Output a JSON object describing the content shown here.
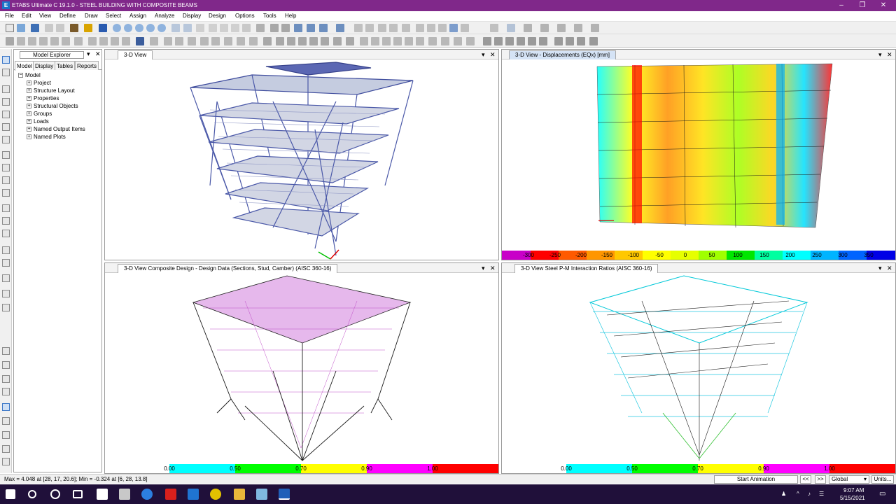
{
  "window": {
    "title": "ETABS Ultimate C 19.1.0 - STEEL BUILDING WITH COMPOSITE BEAMS",
    "logo_letter": "E",
    "minimize": "–",
    "restore": "❐",
    "close": "✕"
  },
  "menu": [
    "File",
    "Edit",
    "View",
    "Define",
    "Draw",
    "Select",
    "Assign",
    "Analyze",
    "Display",
    "Design",
    "Options",
    "Tools",
    "Help"
  ],
  "explorer": {
    "title": "Model Explorer",
    "pin": "▾",
    "close": "✕",
    "tabs": [
      "Model",
      "Display",
      "Tables",
      "Reports"
    ],
    "active_tab": "Model",
    "tree_root": "Model",
    "tree_items": [
      "Project",
      "Structure Layout",
      "Properties",
      "Structural Objects",
      "Groups",
      "Loads",
      "Named Output Items",
      "Named Plots"
    ]
  },
  "panes": {
    "top_left": {
      "title": "3-D View"
    },
    "top_right": {
      "title": "3-D View  - Displacements (EQx)  [mm]"
    },
    "bottom_left": {
      "title": "3-D View  Composite Design - Design Data (Sections, Stud, Camber)  (AISC 360-16)"
    },
    "bottom_right": {
      "title": "3-D View  Steel P-M Interaction Ratios  (AISC 360-16)"
    },
    "pane_dropdown": "▾",
    "pane_close": "✕"
  },
  "displacement_scale": {
    "labels": [
      "-300",
      "-250",
      "-200",
      "-150",
      "-100",
      "-50",
      "0",
      "50",
      "100",
      "150",
      "200",
      "250",
      "300",
      "350"
    ],
    "colors": [
      "#c800c8",
      "#ff0000",
      "#ff5a00",
      "#ff9600",
      "#ffc800",
      "#ffff00",
      "#e6ff00",
      "#a0ff00",
      "#00e600",
      "#00ffa0",
      "#00ffff",
      "#00b4ff",
      "#0064ff",
      "#0000e6"
    ]
  },
  "ratio_scale": {
    "labels": [
      "0.00",
      "0.50",
      "0.70",
      "0.90",
      "1.00"
    ],
    "colors": [
      "#ffffff",
      "#00ffff",
      "#00ff00",
      "#ffff00",
      "#ff00ff",
      "#ff0000"
    ]
  },
  "status": {
    "text": "Max = 4.048 at [28, 17, 20.6];  Min = -0.324 at [6, 28, 13.8]",
    "start_animation": "Start Animation",
    "prev": "<<",
    "next": ">>",
    "coord_system": "Global",
    "units": "Units..."
  },
  "taskbar": {
    "time": "9:07 AM",
    "date": "5/15/2021"
  }
}
